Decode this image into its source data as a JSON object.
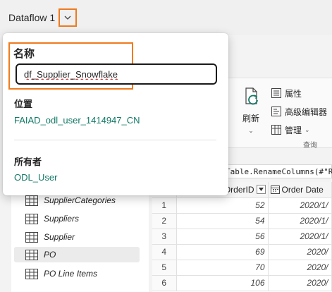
{
  "app": {
    "title": "Dataflow 1"
  },
  "popup": {
    "name_label": "名称",
    "name_value": "df_Supplier_Snowflake",
    "location_label": "位置",
    "location_value": "FAIAD_odl_user_1414947_CN",
    "owner_label": "所有者",
    "owner_value": "ODL_User"
  },
  "ribbon": {
    "refresh_label": "刷新",
    "properties_label": "属性",
    "advanced_editor_label": "高级编辑器",
    "manage_label": "管理",
    "group_label": "查询"
  },
  "formula": {
    "text": "Table.RenameColumns(#\"R"
  },
  "queries": {
    "items": [
      {
        "label": "SupplierCategories"
      },
      {
        "label": "Suppliers"
      },
      {
        "label": "Supplier"
      },
      {
        "label": "PO"
      },
      {
        "label": "PO Line Items"
      }
    ]
  },
  "grid": {
    "columns": [
      "OrderID",
      "Order Date"
    ],
    "rows": [
      {
        "n": "1",
        "order_id": "52",
        "order_date": "2020/1/"
      },
      {
        "n": "2",
        "order_id": "54",
        "order_date": "2020/1/"
      },
      {
        "n": "3",
        "order_id": "56",
        "order_date": "2020/1/"
      },
      {
        "n": "4",
        "order_id": "69",
        "order_date": "2020/"
      },
      {
        "n": "5",
        "order_id": "70",
        "order_date": "2020/"
      },
      {
        "n": "6",
        "order_id": "106",
        "order_date": "2020/"
      }
    ]
  },
  "colors": {
    "accent": "#117865",
    "highlight": "#f07a1d"
  }
}
